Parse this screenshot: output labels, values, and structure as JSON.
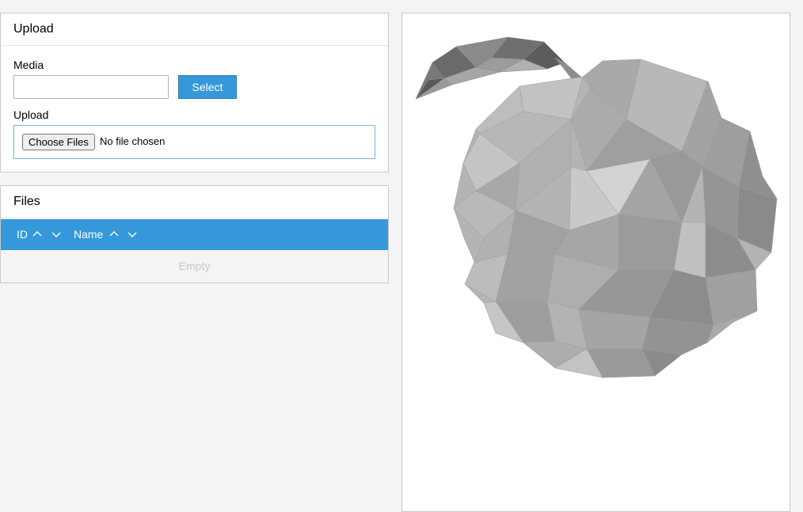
{
  "upload_panel": {
    "title": "Upload",
    "media_label": "Media",
    "media_value": "",
    "select_label": "Select",
    "upload_label": "Upload",
    "choose_files_label": "Choose Files",
    "no_file_text": "No file chosen"
  },
  "files_panel": {
    "title": "Files",
    "columns": [
      {
        "label": "ID"
      },
      {
        "label": "Name"
      }
    ],
    "empty_text": "Empty"
  },
  "colors": {
    "accent": "#3498db",
    "background": "#f4f4f4",
    "panel_border": "#c8c8c8"
  },
  "icons": {
    "sort_asc": "chevron-up-icon",
    "sort_desc": "chevron-down-icon"
  }
}
